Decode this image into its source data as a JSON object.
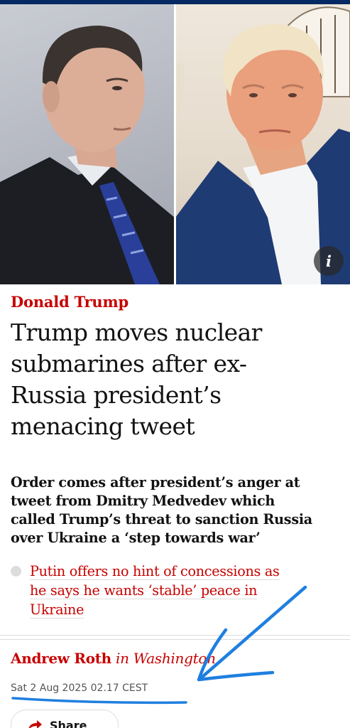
{
  "hero": {
    "left_subject": "man in dark suit with blue striped tie",
    "right_subject": "man in navy jacket with white shirt",
    "info_label": "i"
  },
  "article": {
    "kicker": "Donald Trump",
    "headline_lines": [
      "Trump moves nuclear",
      "submarines after ex-",
      "Russia president’s",
      "menacing tweet"
    ],
    "standfirst_lines": [
      "Order comes after president’s anger at",
      "tweet from Dmitry Medvedev which",
      "called Trump’s threat to sanction Russia",
      "over Ukraine a ‘step towards war’"
    ],
    "related_lines": [
      "Putin offers no hint of concessions as",
      "he says he wants ‘stable’ peace in",
      "Ukraine"
    ],
    "byline_author": "Andrew Roth",
    "byline_location": "in Washington",
    "dateline": "Sat 2 Aug 2025 02.17 CEST",
    "share_label": "Share"
  },
  "colors": {
    "kicker": "#c70000",
    "headline": "#121212",
    "rule": "#dcdcdc",
    "topbar": "#052962",
    "annotation": "#1f7fe0"
  },
  "icons": {
    "info": "info-icon",
    "share": "share-icon",
    "bullet": "bullet-icon",
    "annotation": "hand-drawn-arrow-icon"
  }
}
